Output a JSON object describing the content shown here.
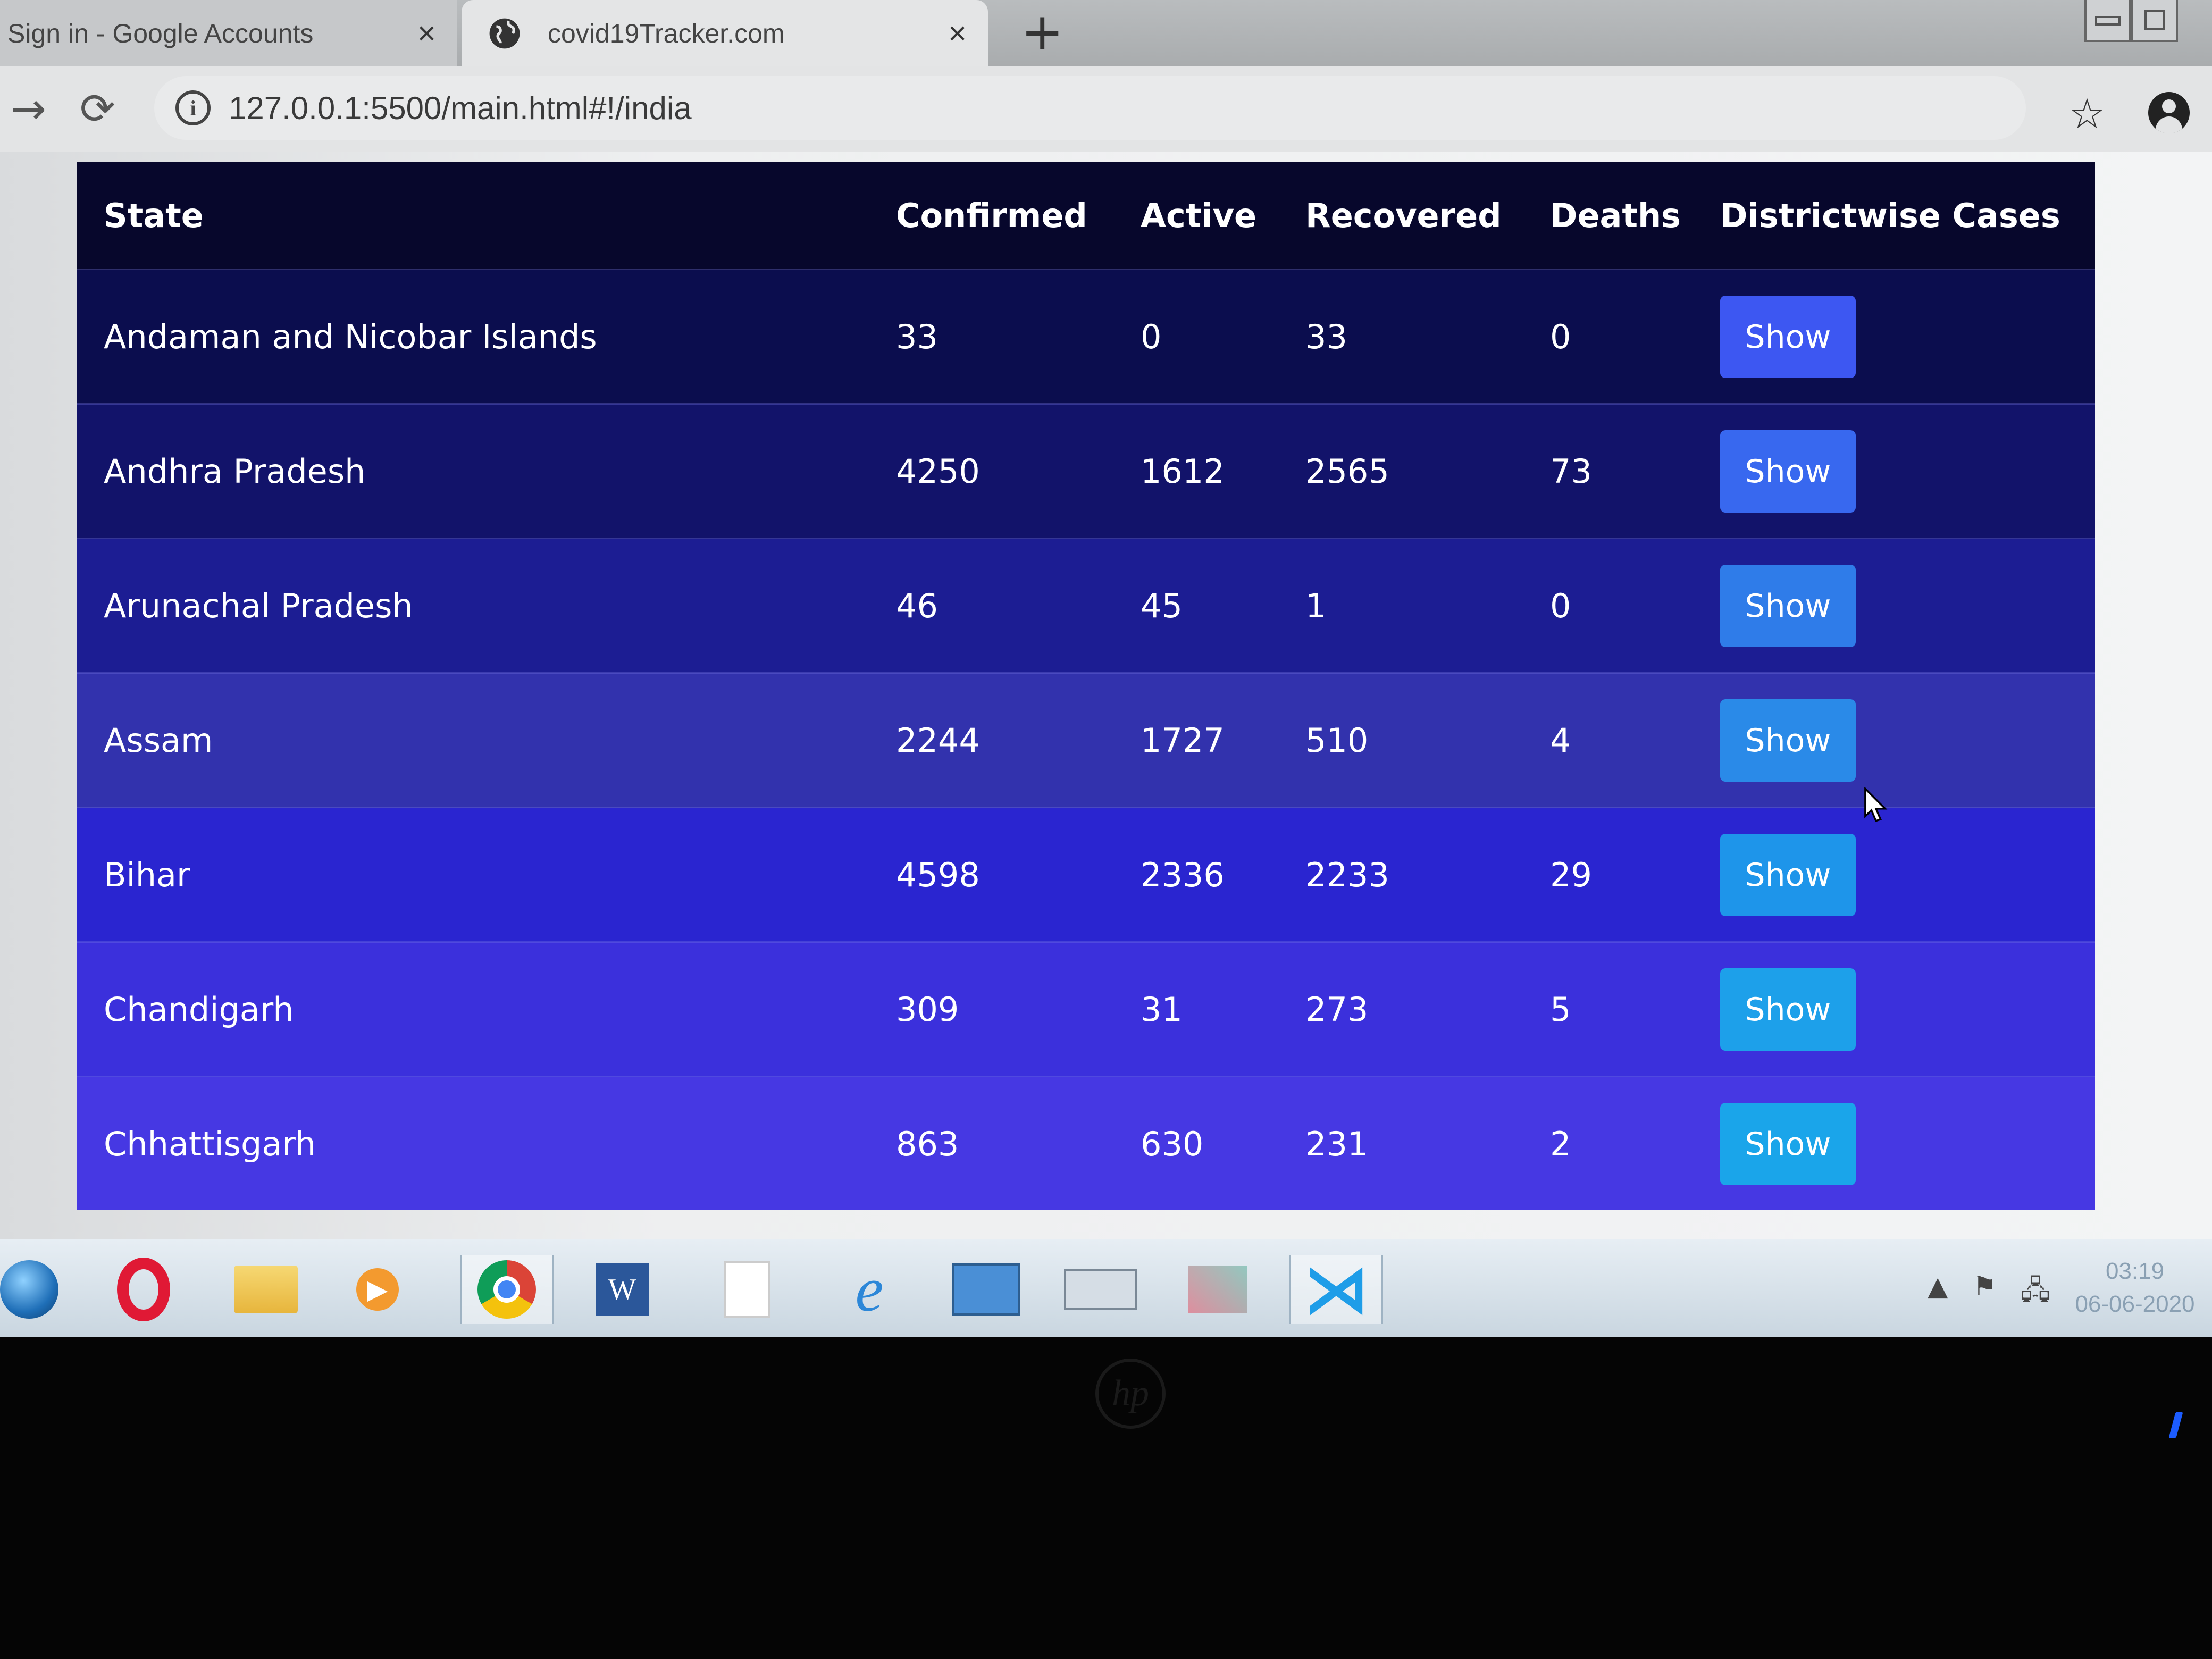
{
  "browser": {
    "tabs": [
      {
        "title": "Sign in - Google Accounts",
        "close": "×"
      },
      {
        "title": "covid19Tracker.com",
        "close": "×"
      }
    ],
    "new_tab": "+",
    "url": "127.0.0.1:5500/main.html#!/india",
    "info_glyph": "i",
    "star_glyph": "☆",
    "forward_glyph": "→",
    "reload_glyph": "⟳"
  },
  "table": {
    "headers": {
      "state": "State",
      "confirmed": "Confirmed",
      "active": "Active",
      "recovered": "Recovered",
      "deaths": "Deaths",
      "districtwise": "Districtwise Cases"
    },
    "rows": [
      {
        "state": "Andaman and Nicobar Islands",
        "confirmed": "33",
        "active": "0",
        "recovered": "33",
        "deaths": "0",
        "action": "Show"
      },
      {
        "state": "Andhra Pradesh",
        "confirmed": "4250",
        "active": "1612",
        "recovered": "2565",
        "deaths": "73",
        "action": "Show"
      },
      {
        "state": "Arunachal Pradesh",
        "confirmed": "46",
        "active": "45",
        "recovered": "1",
        "deaths": "0",
        "action": "Show"
      },
      {
        "state": "Assam",
        "confirmed": "2244",
        "active": "1727",
        "recovered": "510",
        "deaths": "4",
        "action": "Show"
      },
      {
        "state": "Bihar",
        "confirmed": "4598",
        "active": "2336",
        "recovered": "2233",
        "deaths": "29",
        "action": "Show"
      },
      {
        "state": "Chandigarh",
        "confirmed": "309",
        "active": "31",
        "recovered": "273",
        "deaths": "5",
        "action": "Show"
      },
      {
        "state": "Chhattisgarh",
        "confirmed": "863",
        "active": "630",
        "recovered": "231",
        "deaths": "2",
        "action": "Show"
      }
    ]
  },
  "taskbar": {
    "clock_time": "03:19",
    "clock_date": "06-06-2020",
    "tray_up": "▲",
    "tray_flag": "⚑",
    "tray_network": "🖧",
    "word_glyph": "W",
    "ie_glyph": "e",
    "vscode_glyph": "⋊",
    "media_glyph": "▶"
  },
  "bezel": {
    "logo": "hp"
  }
}
